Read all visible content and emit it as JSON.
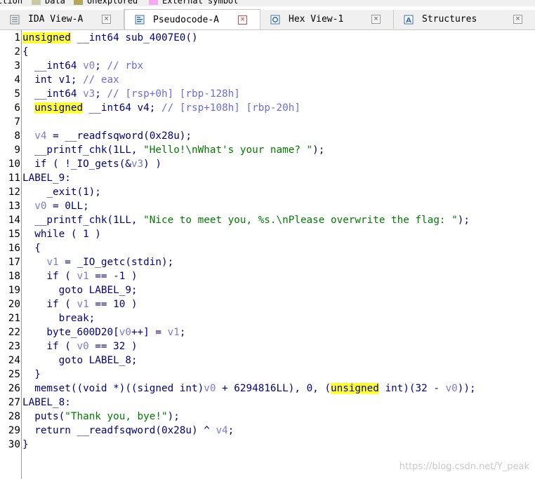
{
  "legend": [
    {
      "label": "ction",
      "color": ""
    },
    {
      "label": "Data",
      "color": "#c9c9a3"
    },
    {
      "label": "Unexplored",
      "color": "#b3a75a"
    },
    {
      "label": "External symbol",
      "color": "#f7a8f0"
    }
  ],
  "tabs": [
    {
      "label": "IDA View-A",
      "icon": "ida-view-icon",
      "close": "×",
      "active": false
    },
    {
      "label": "Pseudocode-A",
      "icon": "pseudocode-icon",
      "close": "×",
      "active": true
    },
    {
      "label": "Hex View-1",
      "icon": "hex-view-icon",
      "close": "×",
      "active": false
    },
    {
      "label": "Structures",
      "icon": "structures-icon",
      "close": "×",
      "active": false
    }
  ],
  "code_lines": [
    {
      "n": "1",
      "bp": false,
      "segs": [
        {
          "t": "unsigned",
          "c": "hl"
        },
        {
          "t": " __int64 sub_4007E0()",
          "c": "k"
        }
      ]
    },
    {
      "n": "2",
      "bp": false,
      "segs": [
        {
          "t": "{",
          "c": "k"
        }
      ]
    },
    {
      "n": "3",
      "bp": false,
      "segs": [
        {
          "t": "  __int64 ",
          "c": "k"
        },
        {
          "t": "v0",
          "c": "v"
        },
        {
          "t": "; ",
          "c": "k"
        },
        {
          "t": "// rbx",
          "c": "c"
        }
      ]
    },
    {
      "n": "4",
      "bp": false,
      "segs": [
        {
          "t": "  int v1; ",
          "c": "k"
        },
        {
          "t": "// eax",
          "c": "c"
        }
      ]
    },
    {
      "n": "5",
      "bp": false,
      "segs": [
        {
          "t": "  __int64 ",
          "c": "k"
        },
        {
          "t": "v3",
          "c": "v"
        },
        {
          "t": "; ",
          "c": "k"
        },
        {
          "t": "// [rsp+0h] [rbp-128h]",
          "c": "c"
        }
      ]
    },
    {
      "n": "6",
      "bp": false,
      "segs": [
        {
          "t": "  ",
          "c": "k"
        },
        {
          "t": "unsigned",
          "c": "hl"
        },
        {
          "t": " __int64 v4; ",
          "c": "k"
        },
        {
          "t": "// [rsp+108h] [rbp-20h]",
          "c": "c"
        }
      ]
    },
    {
      "n": "7",
      "bp": false,
      "segs": []
    },
    {
      "n": "8",
      "bp": true,
      "segs": [
        {
          "t": "  ",
          "c": "k"
        },
        {
          "t": "v4",
          "c": "v"
        },
        {
          "t": " = __readfsqword(0x28u);",
          "c": "k"
        }
      ]
    },
    {
      "n": "9",
      "bp": true,
      "segs": [
        {
          "t": "  __printf_chk(1LL, ",
          "c": "k"
        },
        {
          "t": "\"Hello!\\nWhat's your name? \"",
          "c": "s"
        },
        {
          "t": ");",
          "c": "k"
        }
      ]
    },
    {
      "n": "10",
      "bp": true,
      "segs": [
        {
          "t": "  if ( !_IO_gets(&",
          "c": "k"
        },
        {
          "t": "v3",
          "c": "v"
        },
        {
          "t": ") )",
          "c": "k"
        }
      ]
    },
    {
      "n": "11",
      "bp": false,
      "segs": [
        {
          "t": "LABEL_9:",
          "c": "k"
        }
      ]
    },
    {
      "n": "12",
      "bp": true,
      "segs": [
        {
          "t": "    _exit(1);",
          "c": "k"
        }
      ]
    },
    {
      "n": "13",
      "bp": true,
      "segs": [
        {
          "t": "  ",
          "c": "k"
        },
        {
          "t": "v0",
          "c": "v"
        },
        {
          "t": " = 0LL;",
          "c": "k"
        }
      ]
    },
    {
      "n": "14",
      "bp": true,
      "segs": [
        {
          "t": "  __printf_chk(1LL, ",
          "c": "k"
        },
        {
          "t": "\"Nice to meet you, %s.\\nPlease overwrite the flag: \"",
          "c": "s"
        },
        {
          "t": ");",
          "c": "k"
        }
      ]
    },
    {
      "n": "15",
      "bp": true,
      "segs": [
        {
          "t": "  while ( 1 )",
          "c": "k"
        }
      ]
    },
    {
      "n": "16",
      "bp": false,
      "segs": [
        {
          "t": "  {",
          "c": "k"
        }
      ]
    },
    {
      "n": "17",
      "bp": true,
      "segs": [
        {
          "t": "    ",
          "c": "k"
        },
        {
          "t": "v1",
          "c": "v"
        },
        {
          "t": " = _IO_getc(stdin);",
          "c": "k"
        }
      ]
    },
    {
      "n": "18",
      "bp": true,
      "segs": [
        {
          "t": "    if ( ",
          "c": "k"
        },
        {
          "t": "v1",
          "c": "v"
        },
        {
          "t": " == -1 )",
          "c": "k"
        }
      ]
    },
    {
      "n": "19",
      "bp": true,
      "segs": [
        {
          "t": "      goto LABEL_9;",
          "c": "k"
        }
      ]
    },
    {
      "n": "20",
      "bp": true,
      "segs": [
        {
          "t": "    if ( ",
          "c": "k"
        },
        {
          "t": "v1",
          "c": "v"
        },
        {
          "t": " == 10 )",
          "c": "k"
        }
      ]
    },
    {
      "n": "21",
      "bp": true,
      "segs": [
        {
          "t": "      break;",
          "c": "k"
        }
      ]
    },
    {
      "n": "22",
      "bp": true,
      "segs": [
        {
          "t": "    byte_600D20[",
          "c": "k"
        },
        {
          "t": "v0",
          "c": "v"
        },
        {
          "t": "++] = ",
          "c": "k"
        },
        {
          "t": "v1",
          "c": "v"
        },
        {
          "t": ";",
          "c": "k"
        }
      ]
    },
    {
      "n": "23",
      "bp": true,
      "segs": [
        {
          "t": "    if ( ",
          "c": "k"
        },
        {
          "t": "v0",
          "c": "v"
        },
        {
          "t": " == 32 )",
          "c": "k"
        }
      ]
    },
    {
      "n": "24",
      "bp": true,
      "segs": [
        {
          "t": "      goto LABEL_8;",
          "c": "k"
        }
      ]
    },
    {
      "n": "25",
      "bp": false,
      "segs": [
        {
          "t": "  }",
          "c": "k"
        }
      ]
    },
    {
      "n": "26",
      "bp": true,
      "segs": [
        {
          "t": "  memset((void *)((signed int)",
          "c": "k"
        },
        {
          "t": "v0",
          "c": "v"
        },
        {
          "t": " + 6294816LL), 0, (",
          "c": "k"
        },
        {
          "t": "unsigned",
          "c": "hl"
        },
        {
          "t": " int)(32 - ",
          "c": "k"
        },
        {
          "t": "v0",
          "c": "v"
        },
        {
          "t": "));",
          "c": "k"
        }
      ]
    },
    {
      "n": "27",
      "bp": false,
      "segs": [
        {
          "t": "LABEL_8:",
          "c": "k"
        }
      ]
    },
    {
      "n": "28",
      "bp": true,
      "segs": [
        {
          "t": "  puts(",
          "c": "k"
        },
        {
          "t": "\"Thank you, bye!\"",
          "c": "s"
        },
        {
          "t": ");",
          "c": "k"
        }
      ]
    },
    {
      "n": "29",
      "bp": true,
      "segs": [
        {
          "t": "  return __readfsqword(0x28u) ^ ",
          "c": "k"
        },
        {
          "t": "v4",
          "c": "v"
        },
        {
          "t": ";",
          "c": "k"
        }
      ]
    },
    {
      "n": "30",
      "bp": true,
      "segs": [
        {
          "t": "}",
          "c": "k"
        }
      ]
    }
  ],
  "watermark": "https://blog.csdn.net/Y_peak"
}
